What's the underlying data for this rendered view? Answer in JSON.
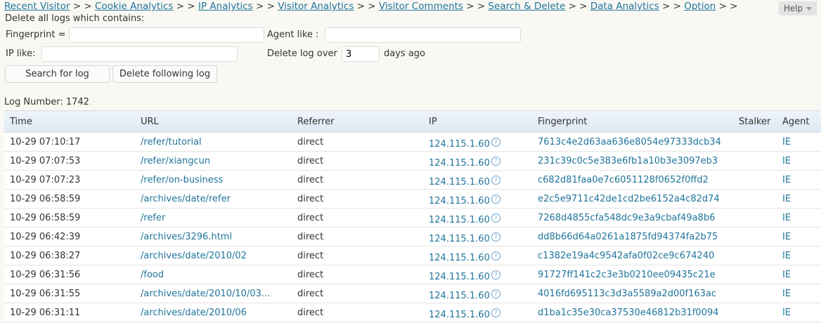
{
  "nav": {
    "items": [
      "Recent Visitor",
      "Cookie Analytics",
      "IP Analytics",
      "Visitor Analytics",
      "Visitor Comments",
      "Search & Delete",
      "Data Analytics",
      "Option"
    ],
    "separator": "> >"
  },
  "help": {
    "label": "Help"
  },
  "form": {
    "heading": "Delete all logs which contains:",
    "fingerprint_label": "Fingerprint =",
    "fingerprint_value": "",
    "agent_label": "Agent like :",
    "agent_value": "",
    "ip_label": "IP like:",
    "ip_value": "",
    "delete_over_label": "Delete log over",
    "delete_over_value": "3",
    "days_ago_label": "days ago",
    "search_button": "Search for log",
    "delete_button": "Delete following log"
  },
  "log_number": "Log Number: 1742",
  "table": {
    "columns": [
      "Time",
      "URL",
      "Referrer",
      "IP",
      "Fingerprint",
      "Stalker",
      "Agent"
    ],
    "rows": [
      {
        "time": "10-29 07:10:17",
        "url": "/refer/tutorial",
        "referrer": "direct",
        "ip": "124.115.1.60",
        "fingerprint": "7613c4e2d63aa636e8054e97333dcb34",
        "stalker": "",
        "agent": "IE"
      },
      {
        "time": "10-29 07:07:53",
        "url": "/refer/xiangcun",
        "referrer": "direct",
        "ip": "124.115.1.60",
        "fingerprint": "231c39c0c5e383e6fb1a10b3e3097eb3",
        "stalker": "",
        "agent": "IE"
      },
      {
        "time": "10-29 07:07:23",
        "url": "/refer/on-business",
        "referrer": "direct",
        "ip": "124.115.1.60",
        "fingerprint": "c682d81faa0e7c6051128f0652f0ffd2",
        "stalker": "",
        "agent": "IE"
      },
      {
        "time": "10-29 06:58:59",
        "url": "/archives/date/refer",
        "referrer": "direct",
        "ip": "124.115.1.60",
        "fingerprint": "e2c5e9711c42de1cd2be6152a4c82d74",
        "stalker": "",
        "agent": "IE"
      },
      {
        "time": "10-29 06:58:59",
        "url": "/refer",
        "referrer": "direct",
        "ip": "124.115.1.60",
        "fingerprint": "7268d4855cfa548dc9e3a9cbaf49a8b6",
        "stalker": "",
        "agent": "IE"
      },
      {
        "time": "10-29 06:42:39",
        "url": "/archives/3296.html",
        "referrer": "direct",
        "ip": "124.115.1.60",
        "fingerprint": "dd8b66d64a0261a1875fd94374fa2b75",
        "stalker": "",
        "agent": "IE"
      },
      {
        "time": "10-29 06:38:27",
        "url": "/archives/date/2010/02",
        "referrer": "direct",
        "ip": "124.115.1.60",
        "fingerprint": "c1382e19a4c9542afa0f02ce9c674240",
        "stalker": "",
        "agent": "IE"
      },
      {
        "time": "10-29 06:31:56",
        "url": "/food",
        "referrer": "direct",
        "ip": "124.115.1.60",
        "fingerprint": "91727ff141c2c3e3b0210ee09435c21e",
        "stalker": "",
        "agent": "IE"
      },
      {
        "time": "10-29 06:31:55",
        "url": "/archives/date/2010/10/03...",
        "referrer": "direct",
        "ip": "124.115.1.60",
        "fingerprint": "4016fd695113c3d3a5589a2d00f163ac",
        "stalker": "",
        "agent": "IE"
      },
      {
        "time": "10-29 06:31:11",
        "url": "/archives/date/2010/06",
        "referrer": "direct",
        "ip": "124.115.1.60",
        "fingerprint": "d1ba1c35e30ca37530e46812b31f0094",
        "stalker": "",
        "agent": "IE"
      }
    ]
  }
}
